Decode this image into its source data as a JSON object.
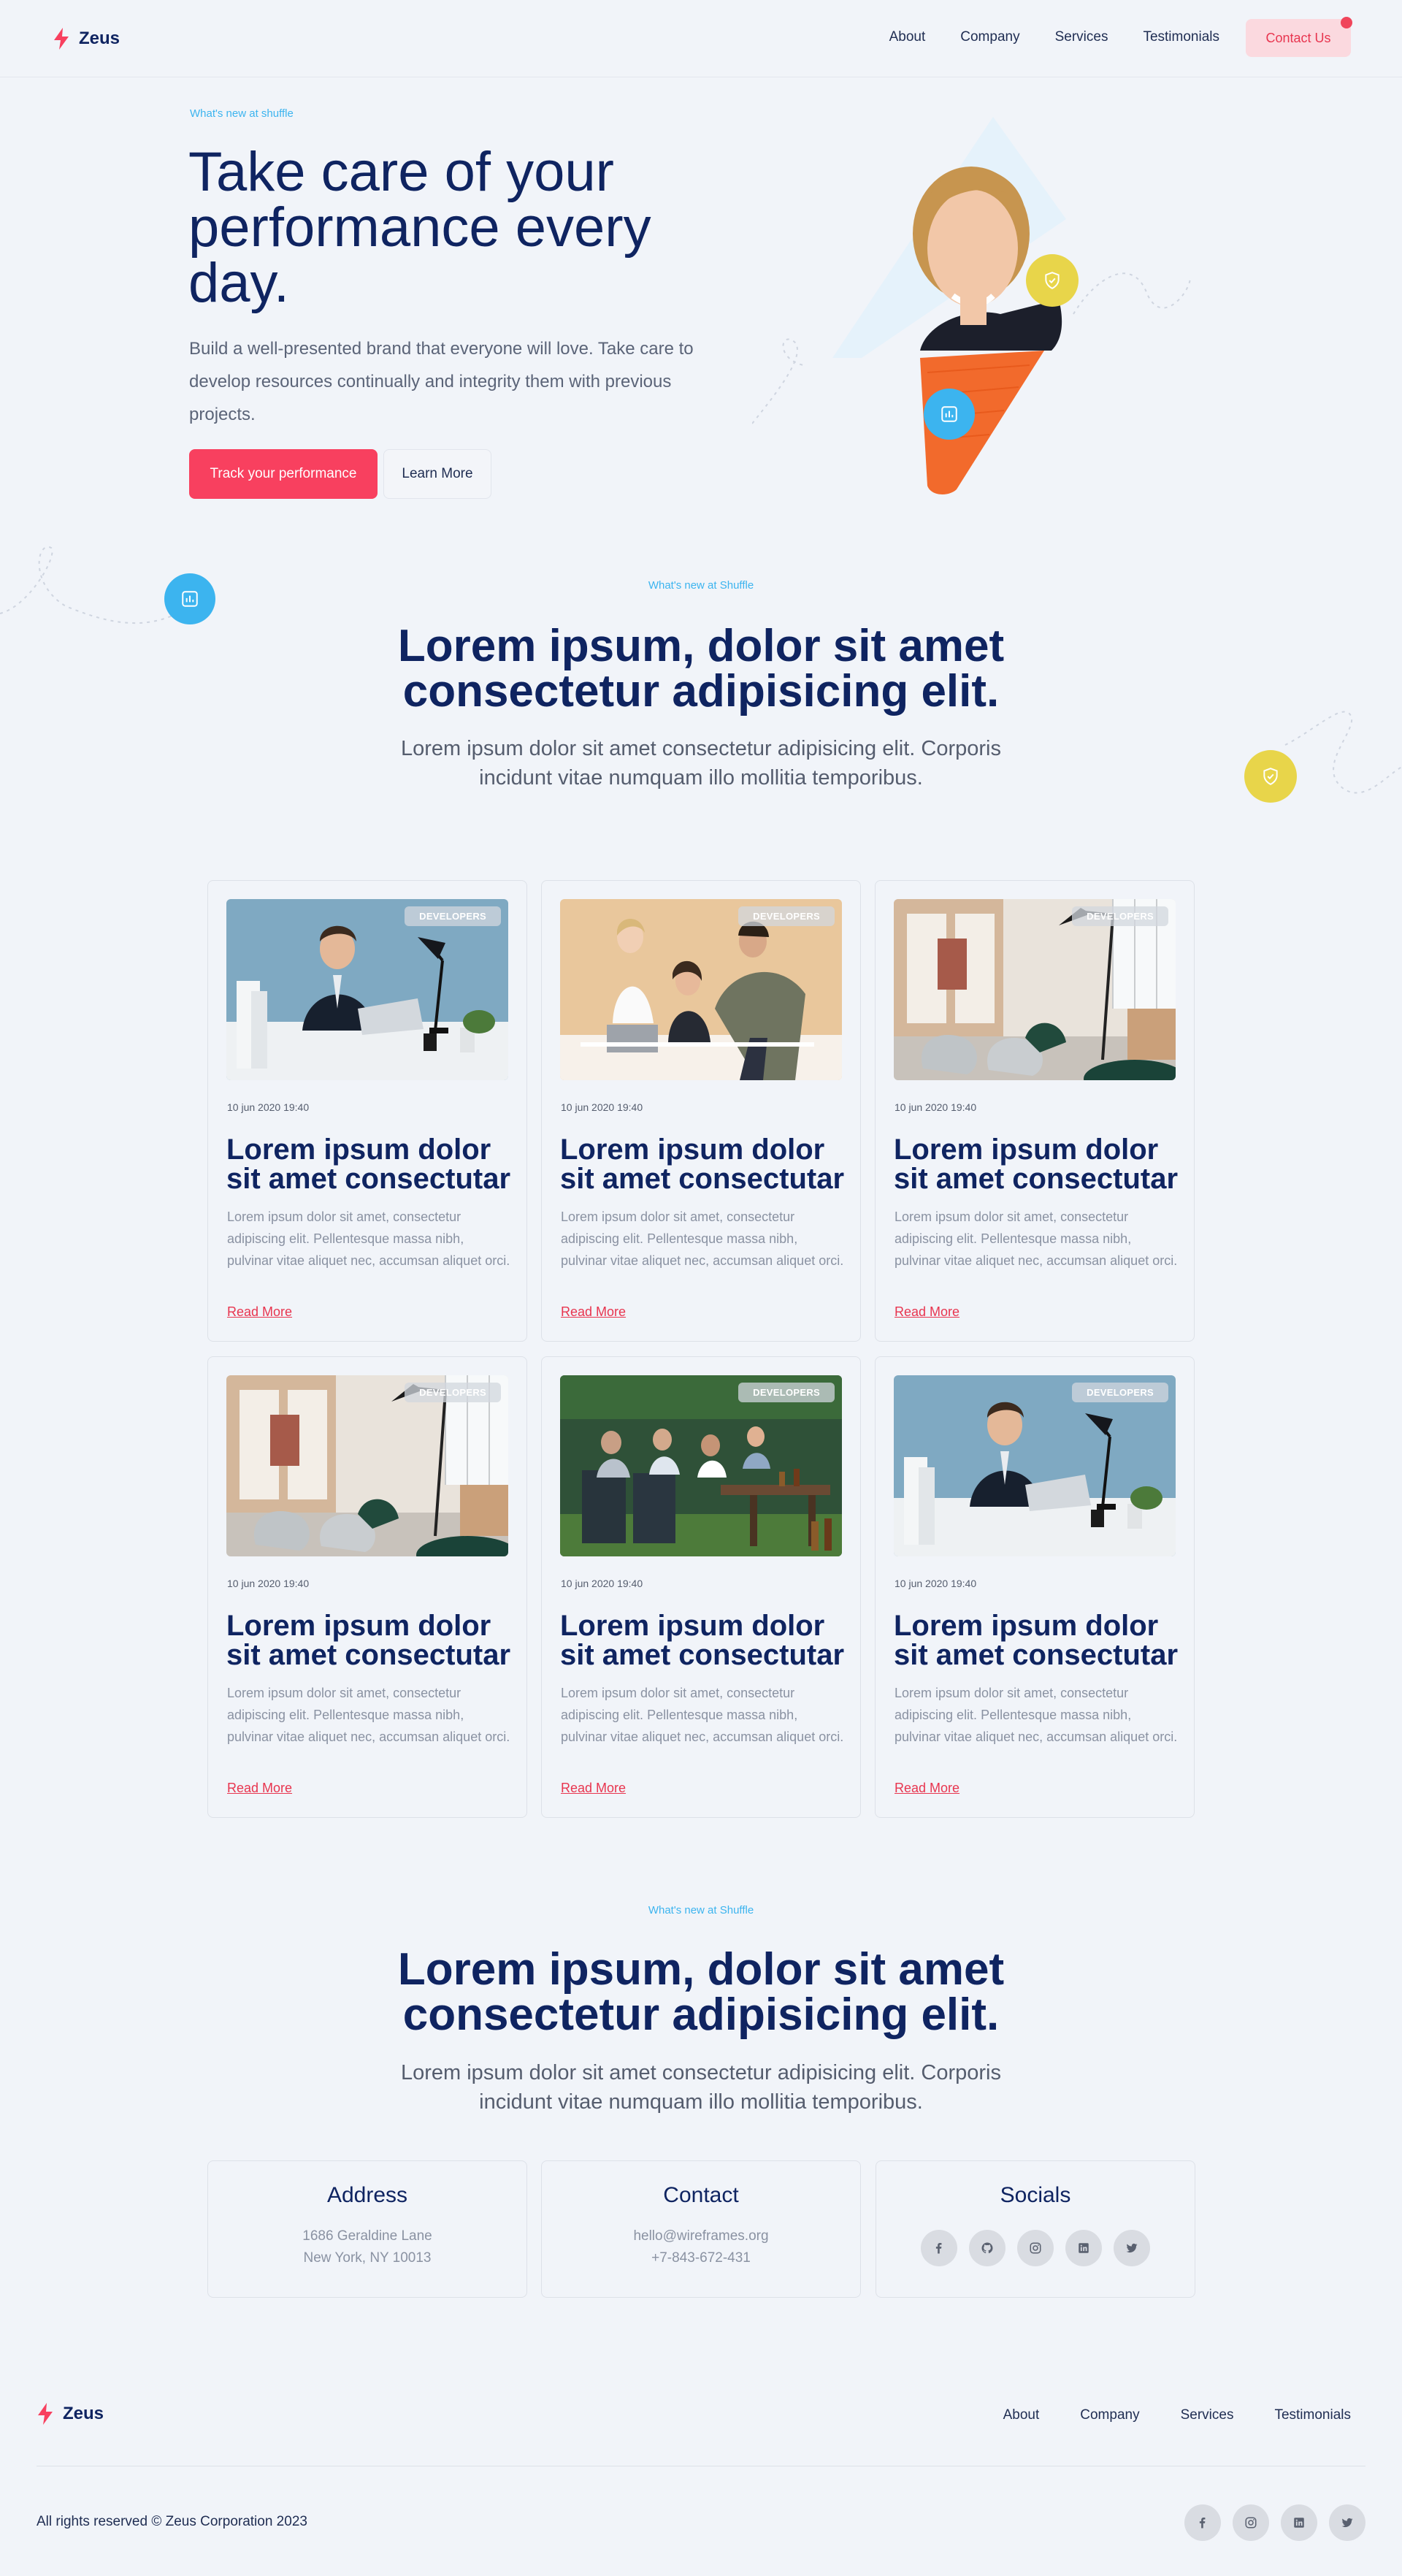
{
  "brand": {
    "name": "Zeus",
    "accent": "#f8405f",
    "navy": "#0f2461",
    "sky": "#3cb4ef",
    "yellow": "#e8d54a"
  },
  "nav": {
    "links": [
      "About",
      "Company",
      "Services",
      "Testimonials"
    ],
    "contact_label": "Contact Us"
  },
  "hero": {
    "eyebrow": "What's new at shuffle",
    "title": "Take care of your performance every day.",
    "subtitle": "Build a well-presented brand that everyone will love. Take care to develop resources continually and integrity them with previous projects.",
    "primary_label": "Track your performance",
    "secondary_label": "Learn More"
  },
  "section1": {
    "eyebrow": "What's new at Shuffle",
    "title": "Lorem ipsum, dolor sit amet consectetur adipisicing elit.",
    "subtitle": "Lorem ipsum dolor sit amet consectetur adipisicing elit. Corporis incidunt vitae numquam illo mollitia temporibus."
  },
  "cards": [
    {
      "badge": "DEVELOPERS",
      "image": "office-man-at-desk",
      "date": "10 jun 2020 19:40",
      "title": "Lorem ipsum dolor sit amet consectutar",
      "text": "Lorem ipsum dolor sit amet, consectetur adipiscing elit. Pellentesque massa nibh, pulvinar vitae aliquet nec, accumsan aliquet orci.",
      "link": "Read More"
    },
    {
      "badge": "DEVELOPERS",
      "image": "team-meeting",
      "date": "10 jun 2020 19:40",
      "title": "Lorem ipsum dolor sit amet consectutar",
      "text": "Lorem ipsum dolor sit amet, consectetur adipiscing elit. Pellentesque massa nibh, pulvinar vitae aliquet nec, accumsan aliquet orci.",
      "link": "Read More"
    },
    {
      "badge": "DEVELOPERS",
      "image": "office-lounge",
      "date": "10 jun 2020 19:40",
      "title": "Lorem ipsum dolor sit amet consectutar",
      "text": "Lorem ipsum dolor sit amet, consectetur adipiscing elit. Pellentesque massa nibh, pulvinar vitae aliquet nec, accumsan aliquet orci.",
      "link": "Read More"
    },
    {
      "badge": "DEVELOPERS",
      "image": "office-lounge",
      "date": "10 jun 2020 19:40",
      "title": "Lorem ipsum dolor sit amet consectutar",
      "text": "Lorem ipsum dolor sit amet, consectetur adipiscing elit. Pellentesque massa nibh, pulvinar vitae aliquet nec, accumsan aliquet orci.",
      "link": "Read More"
    },
    {
      "badge": "DEVELOPERS",
      "image": "outdoor-gathering",
      "date": "10 jun 2020 19:40",
      "title": "Lorem ipsum dolor sit amet consectutar",
      "text": "Lorem ipsum dolor sit amet, consectetur adipiscing elit. Pellentesque massa nibh, pulvinar vitae aliquet nec, accumsan aliquet orci.",
      "link": "Read More"
    },
    {
      "badge": "DEVELOPERS",
      "image": "office-man-at-desk",
      "date": "10 jun 2020 19:40",
      "title": "Lorem ipsum dolor sit amet consectutar",
      "text": "Lorem ipsum dolor sit amet, consectetur adipiscing elit. Pellentesque massa nibh, pulvinar vitae aliquet nec, accumsan aliquet orci.",
      "link": "Read More"
    }
  ],
  "section2": {
    "eyebrow": "What's new at Shuffle",
    "title": "Lorem ipsum, dolor sit amet consectetur adipisicing elit.",
    "subtitle": "Lorem ipsum dolor sit amet consectetur adipisicing elit. Corporis incidunt vitae numquam illo mollitia temporibus."
  },
  "address": {
    "title": "Address",
    "line1": "1686 Geraldine Lane",
    "line2": "New York, NY 10013"
  },
  "contact": {
    "title": "Contact",
    "email": "hello@wireframes.org",
    "phone": "+7-843-672-431"
  },
  "socials": {
    "title": "Socials",
    "icons": [
      "facebook-icon",
      "github-icon",
      "instagram-icon",
      "linkedin-icon",
      "twitter-icon"
    ]
  },
  "footer": {
    "links": [
      "About",
      "Company",
      "Services",
      "Testimonials"
    ],
    "copyright": "All rights reserved © Zeus Corporation 2023",
    "icons": [
      "facebook-icon",
      "instagram-icon",
      "linkedin-icon",
      "twitter-icon"
    ]
  }
}
